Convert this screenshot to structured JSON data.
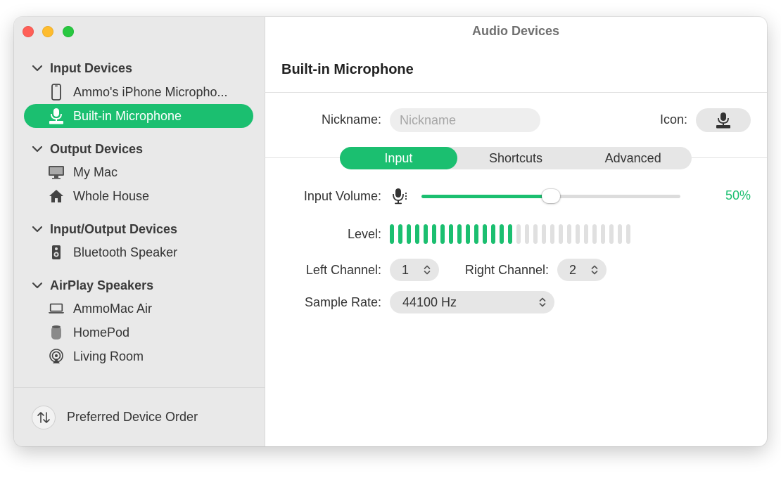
{
  "window": {
    "title": "Audio Devices"
  },
  "sidebar": {
    "groups": [
      {
        "label": "Input Devices",
        "items": [
          {
            "label": "Ammo's iPhone Micropho...",
            "icon": "iphone-icon"
          },
          {
            "label": "Built-in Microphone",
            "icon": "builtin-mic-icon",
            "selected": true
          }
        ]
      },
      {
        "label": "Output Devices",
        "items": [
          {
            "label": "My Mac",
            "icon": "display-icon"
          },
          {
            "label": "Whole House",
            "icon": "house-icon"
          }
        ]
      },
      {
        "label": "Input/Output Devices",
        "items": [
          {
            "label": "Bluetooth Speaker",
            "icon": "speaker-icon"
          }
        ]
      },
      {
        "label": "AirPlay Speakers",
        "items": [
          {
            "label": "AmmoMac Air",
            "icon": "laptop-icon"
          },
          {
            "label": "HomePod",
            "icon": "homepod-icon"
          },
          {
            "label": "Living Room",
            "icon": "airplay-icon"
          }
        ]
      }
    ],
    "footer": {
      "label": "Preferred Device Order",
      "icon": "sort-arrows-icon"
    }
  },
  "main": {
    "device_title": "Built-in Microphone",
    "nickname": {
      "label": "Nickname:",
      "placeholder": "Nickname",
      "value": ""
    },
    "icon_label": "Icon:",
    "tabs": [
      {
        "label": "Input",
        "active": true
      },
      {
        "label": "Shortcuts",
        "active": false
      },
      {
        "label": "Advanced",
        "active": false
      }
    ],
    "input_volume": {
      "label": "Input Volume:",
      "value_text": "50%",
      "fraction": 0.5
    },
    "level": {
      "label": "Level:",
      "total_bars": 29,
      "active_bars": 15
    },
    "left_channel": {
      "label": "Left Channel:",
      "value": "1"
    },
    "right_channel": {
      "label": "Right Channel:",
      "value": "2"
    },
    "sample_rate": {
      "label": "Sample Rate:",
      "value": "44100 Hz"
    }
  },
  "colors": {
    "accent": "#1bbf70",
    "sidebar_bg": "#e9e9e9",
    "close": "#ff5f57",
    "minimize": "#febc2e",
    "maximize": "#28c840"
  }
}
